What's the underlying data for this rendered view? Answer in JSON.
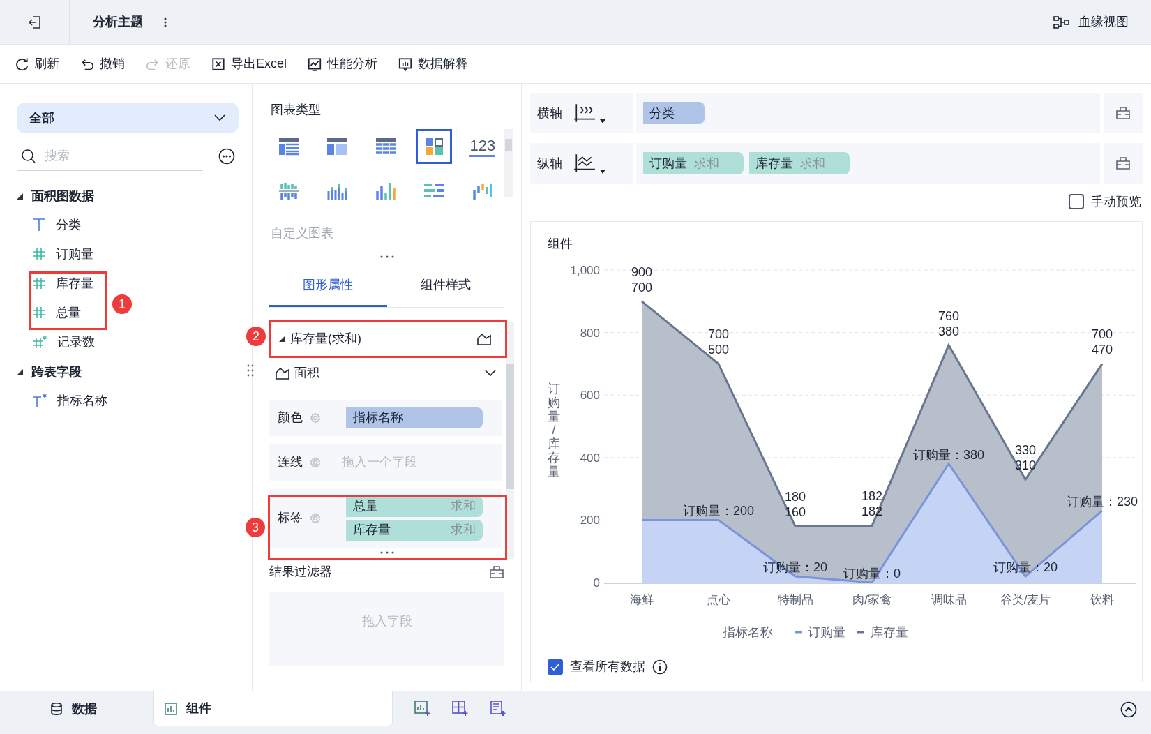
{
  "top_bar": {
    "title": "分析主题",
    "lineage_button": "血缘视图"
  },
  "toolbar": [
    {
      "label": "刷新",
      "disabled": false
    },
    {
      "label": "撤销",
      "disabled": false
    },
    {
      "label": "还原",
      "disabled": true
    },
    {
      "label": "导出Excel",
      "disabled": false
    },
    {
      "label": "性能分析",
      "disabled": false
    },
    {
      "label": "数据解释",
      "disabled": false
    }
  ],
  "data_panel": {
    "scope": "全部",
    "search_placeholder": "搜索",
    "groups": [
      {
        "label": "面积图数据",
        "expanded": true,
        "children": [
          {
            "label": "分类",
            "kind": "text"
          },
          {
            "label": "订购量",
            "kind": "number"
          },
          {
            "label": "库存量",
            "kind": "number"
          },
          {
            "label": "总量",
            "kind": "number"
          },
          {
            "label": "记录数",
            "kind": "calc-number"
          }
        ]
      },
      {
        "label": "跨表字段",
        "expanded": true,
        "children": [
          {
            "label": "指标名称",
            "kind": "calc-text"
          }
        ]
      }
    ]
  },
  "chart_types": {
    "title": "图表类型",
    "items": [
      {
        "kind": "table",
        "selected": false
      },
      {
        "kind": "crosstab",
        "selected": false
      },
      {
        "kind": "detail",
        "selected": false
      },
      {
        "kind": "dashboard",
        "selected": true
      },
      {
        "kind": "number",
        "label": "123",
        "selected": false
      },
      {
        "kind": "bar-group",
        "selected": false
      },
      {
        "kind": "bar-multi",
        "selected": false
      },
      {
        "kind": "bar",
        "selected": false
      },
      {
        "kind": "bar-horizontal",
        "selected": false
      },
      {
        "kind": "waterfall",
        "selected": false
      }
    ],
    "custom": "自定义图表"
  },
  "property_tabs": [
    {
      "label": "图形属性",
      "selected": true
    },
    {
      "label": "组件样式",
      "selected": false
    }
  ],
  "series_section": {
    "title": "库存量(求和)",
    "expanded": true,
    "shape": "面积",
    "properties": [
      {
        "label": "颜色",
        "fields": [
          {
            "name": "指标名称",
            "kind": "dimension"
          }
        ]
      },
      {
        "label": "连线",
        "placeholder": "拖入一个字段"
      },
      {
        "label": "标签",
        "fields": [
          {
            "name": "总量",
            "aggregation": "求和",
            "kind": "measure"
          },
          {
            "name": "库存量",
            "aggregation": "求和",
            "kind": "measure"
          }
        ]
      }
    ]
  },
  "result_filter": {
    "title": "结果过滤器",
    "placeholder": "拖入字段"
  },
  "axes": [
    {
      "label": "横轴",
      "fields": [
        {
          "name": "分类",
          "kind": "dimension"
        }
      ]
    },
    {
      "label": "纵轴",
      "fields": [
        {
          "name": "订购量",
          "aggregation": "求和",
          "kind": "measure"
        },
        {
          "name": "库存量",
          "aggregation": "求和",
          "kind": "measure"
        }
      ]
    }
  ],
  "manual_preview": {
    "label": "手动预览",
    "checked": false
  },
  "widget": {
    "title": "组件",
    "chart_data": {
      "type": "area",
      "stacked": true,
      "grid": true,
      "legend": {
        "title": "指标名称"
      },
      "ylabel": "订购量/库存量",
      "ylim": [
        0,
        1000
      ],
      "yticks": [
        0,
        200,
        400,
        600,
        800,
        {
          "value": 1000,
          "label": "1,000"
        }
      ],
      "categories": [
        "海鲜",
        "点心",
        "特制品",
        "肉/家禽",
        "调味品",
        "谷类/麦片",
        "饮料"
      ],
      "series": [
        {
          "name": "订购量",
          "color": "#7b93dc",
          "values": [
            200,
            200,
            20,
            0,
            380,
            20,
            230
          ],
          "value_labels": [
            null,
            "订购量：200",
            "订购量：20",
            "订购量：0",
            "订购量：380",
            "订购量：20",
            "订购量：230"
          ]
        },
        {
          "name": "库存量",
          "color": "#68778f",
          "values": [
            700,
            500,
            160,
            182,
            380,
            310,
            470
          ],
          "value_labels": [
            [
              "900",
              "700"
            ],
            [
              "700",
              "500"
            ],
            [
              "180",
              "160"
            ],
            [
              "182",
              "182"
            ],
            [
              "760",
              "380"
            ],
            [
              "330",
              "310"
            ],
            [
              "700",
              "470"
            ]
          ]
        }
      ]
    },
    "view_all": {
      "label": "查看所有数据",
      "checked": true
    }
  },
  "bottom_tabs": [
    {
      "label": "数据",
      "selected": false
    },
    {
      "label": "组件",
      "selected": true
    }
  ],
  "annotations": [
    {
      "label": "1"
    },
    {
      "label": "2"
    },
    {
      "label": "3"
    }
  ]
}
